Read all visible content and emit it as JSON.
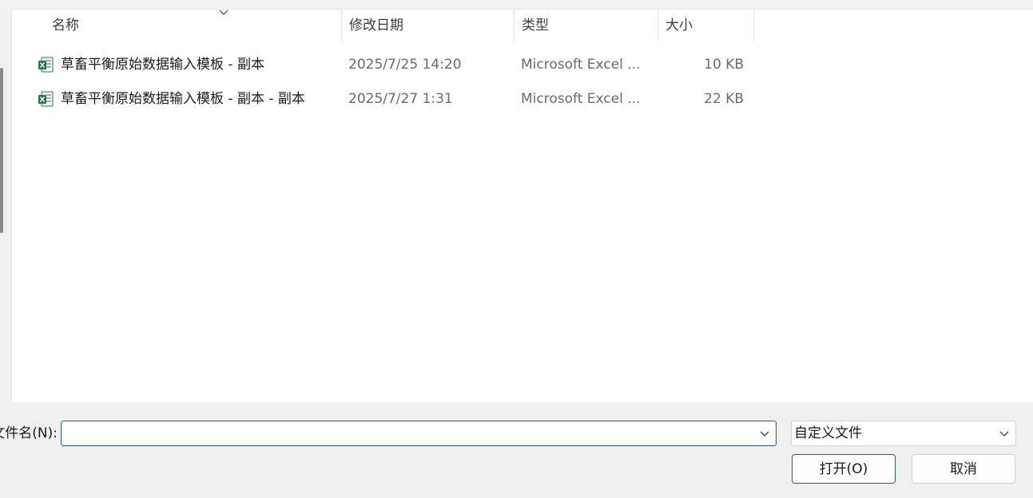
{
  "columns": {
    "name": "名称",
    "modified": "修改日期",
    "type": "类型",
    "size": "大小"
  },
  "files": [
    {
      "name": "草畜平衡原始数据输入模板 - 副本",
      "modified": "2025/7/25 14:20",
      "type": "Microsoft Excel ...",
      "size": "10 KB",
      "icon": "excel-file-icon"
    },
    {
      "name": "草畜平衡原始数据输入模板 - 副本 - 副本",
      "modified": "2025/7/27 1:31",
      "type": "Microsoft Excel ...",
      "size": "22 KB",
      "icon": "excel-file-icon"
    }
  ],
  "filename": {
    "label": "文件名(N):",
    "value": ""
  },
  "filetype": {
    "selected": "自定义文件"
  },
  "buttons": {
    "open": "打开(O)",
    "cancel": "取消"
  },
  "colors": {
    "accent_border": "#1f5aa0",
    "excel_green": "#1d7a45"
  }
}
